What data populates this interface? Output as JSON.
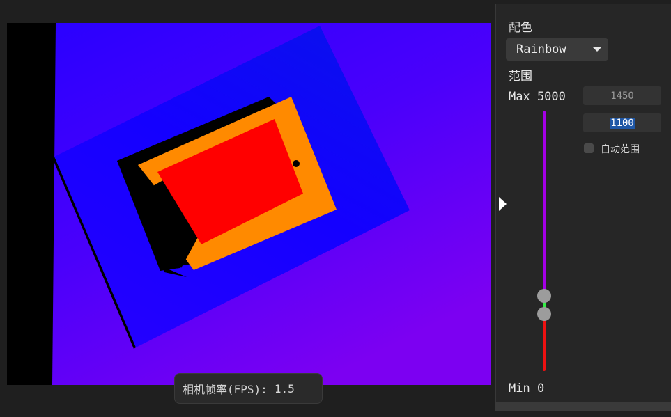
{
  "panel": {
    "colormap_label": "配色",
    "colormap_value": "Rainbow",
    "range_label": "范围",
    "max_label": "Max 5000",
    "min_label": "Min 0",
    "max_input_value": "1450",
    "min_input_value": "1100",
    "auto_range_label": "自动范围",
    "auto_range_checked": false,
    "range_max": 5000,
    "range_min": 0,
    "range_high": 1450,
    "range_low": 1100
  },
  "viewport": {
    "fps_label": "相机帧率(FPS):",
    "fps_value": "1.5"
  },
  "colors": {
    "slider_high": "#a400e6",
    "slider_mid": "#33ee44",
    "slider_low": "#ee1111",
    "depth_far": "#7a00f0",
    "depth_mid": "#1600ff",
    "depth_near_a": "#ff8a00",
    "depth_near_b": "#ff0000"
  }
}
